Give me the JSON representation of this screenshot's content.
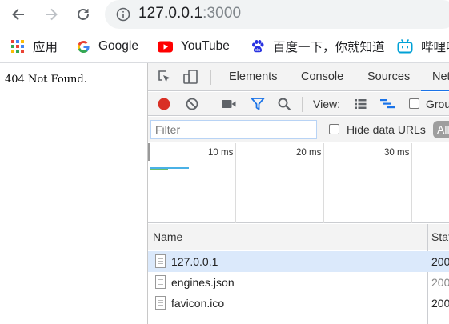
{
  "browser": {
    "url_host": "127.0.0.1",
    "url_port": ":3000",
    "bookmarks": [
      {
        "label": "应用",
        "icon": "apps-grid-icon"
      },
      {
        "label": "Google",
        "icon": "google-icon"
      },
      {
        "label": "YouTube",
        "icon": "youtube-icon"
      },
      {
        "label": "百度一下，你就知道",
        "icon": "baidu-paw-icon"
      },
      {
        "label": "哔哩哔",
        "icon": "bilibili-icon"
      }
    ]
  },
  "page": {
    "body_text": "404 Not Found."
  },
  "devtools": {
    "tabs": [
      {
        "label": "Elements",
        "active": false
      },
      {
        "label": "Console",
        "active": false
      },
      {
        "label": "Sources",
        "active": false
      },
      {
        "label": "Net",
        "active": true
      }
    ],
    "toolbar": {
      "view_label": "View:",
      "group_label": "Grou"
    },
    "filter": {
      "placeholder": "Filter",
      "hide_data_urls_label": "Hide data URLs",
      "all_chip": "All"
    },
    "overview": {
      "ticks": [
        "10 ms",
        "20 ms",
        "30 ms"
      ]
    },
    "table": {
      "columns": [
        "Name",
        "Stat"
      ],
      "rows": [
        {
          "name": "127.0.0.1",
          "status": "200",
          "selected": true,
          "status_muted": false
        },
        {
          "name": "engines.json",
          "status": "200",
          "selected": false,
          "status_muted": true
        },
        {
          "name": "favicon.ico",
          "status": "200",
          "selected": false,
          "status_muted": false
        }
      ]
    }
  },
  "colors": {
    "record_red": "#d93025",
    "filter_blue": "#1a73e8",
    "youtube_red": "#ff0000",
    "bilibili_blue": "#00a1d6",
    "baidu_blue": "#2932e1",
    "selected_row": "#dbe9fb"
  }
}
